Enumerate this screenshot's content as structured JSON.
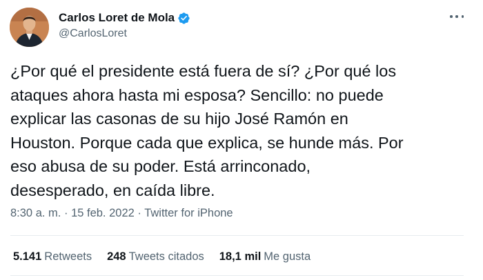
{
  "author": {
    "display_name": "Carlos Loret de Mola",
    "handle": "@CarlosLoret",
    "verified": true
  },
  "more_icon": "more-horizontal-icon",
  "tweet_lines": [
    "¿Por qué el presidente está fuera de sí? ¿Por qué los",
    "ataques ahora hasta mi esposa? Sencillo: no puede",
    "explicar las casonas de su hijo José Ramón en",
    "Houston. Porque cada que explica, se hunde más. Por",
    "eso abusa de su poder. Está arrinconado,",
    "desesperado, en caída libre."
  ],
  "meta": {
    "time": "8:30 a. m.",
    "separator": "·",
    "date": "15 feb. 2022",
    "source": "Twitter for iPhone"
  },
  "stats": [
    {
      "count": "5.141",
      "label": "Retweets"
    },
    {
      "count": "248",
      "label": "Tweets citados"
    },
    {
      "count": "18,1 mil",
      "label": "Me gusta"
    }
  ],
  "colors": {
    "verified_badge": "#1d9bf0",
    "secondary_text": "#536471",
    "divider": "#e6ebee"
  }
}
